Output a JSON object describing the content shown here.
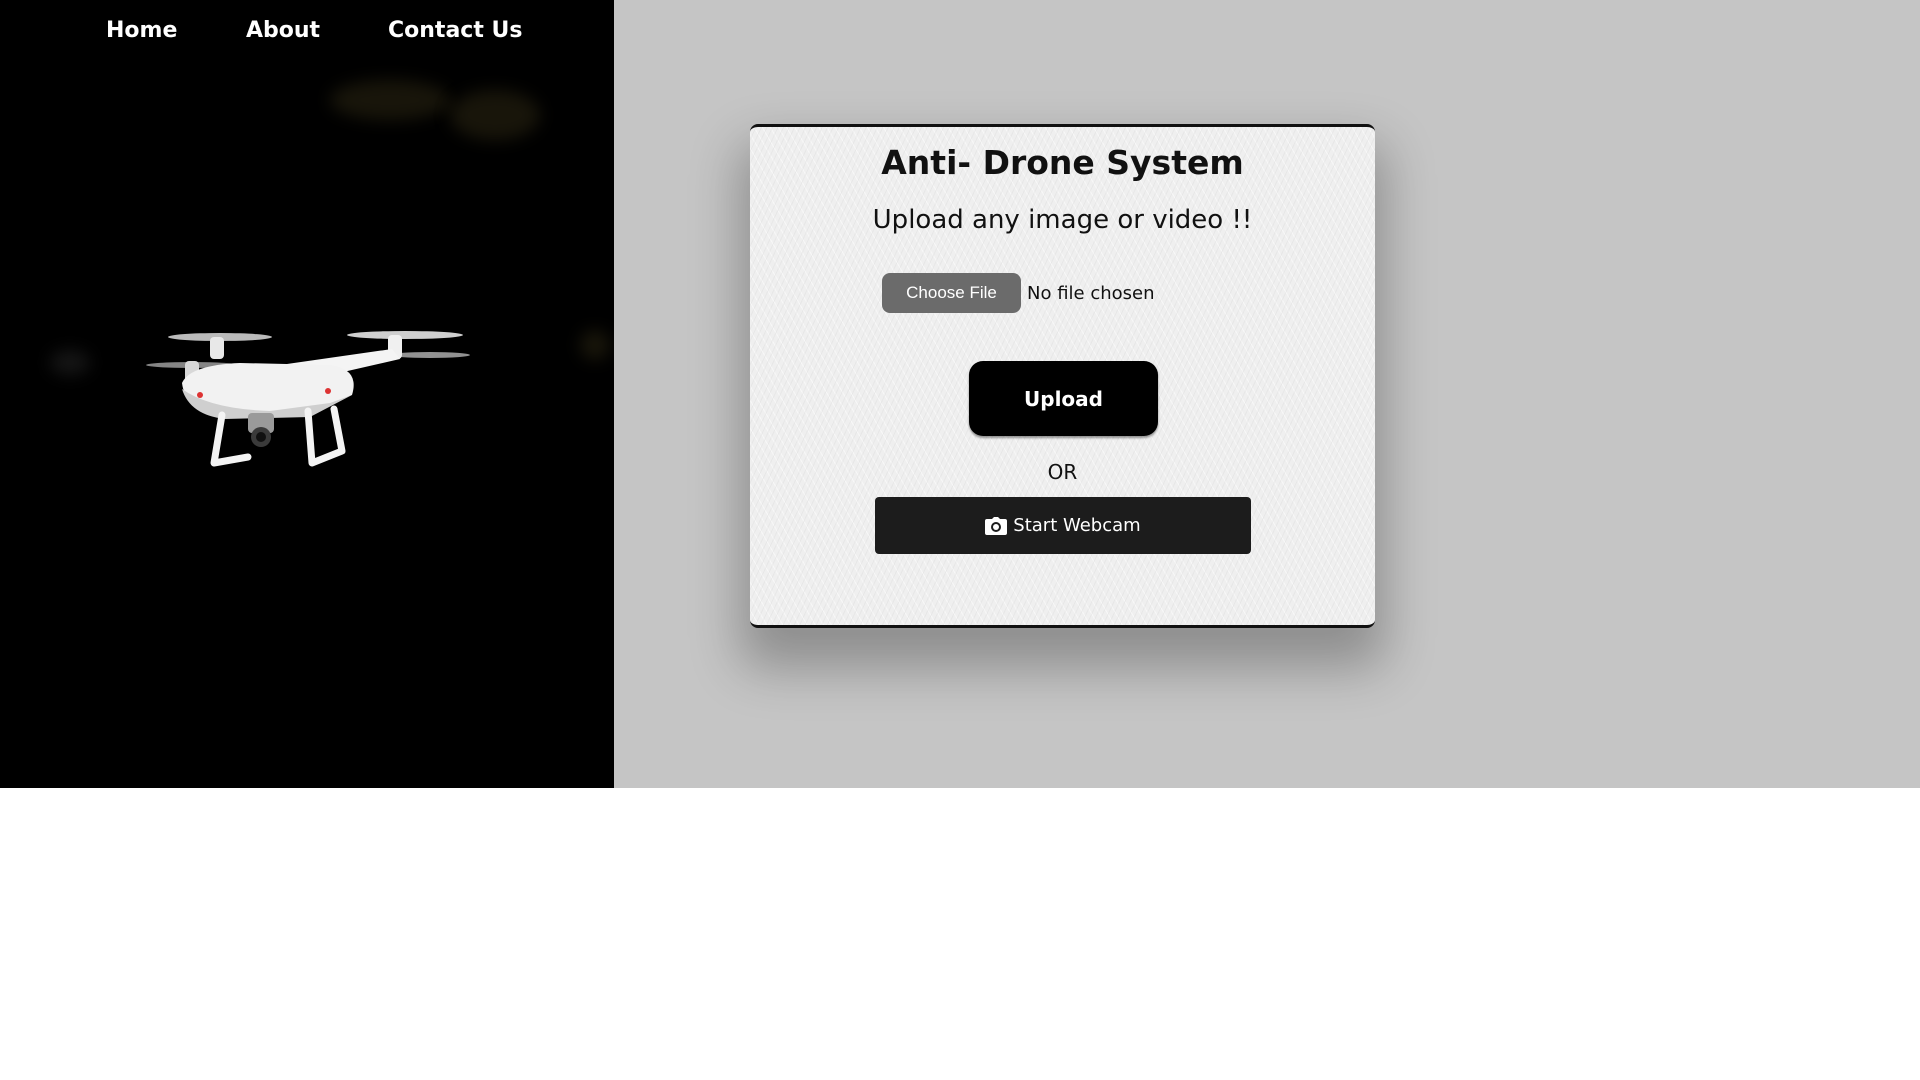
{
  "nav": {
    "items": [
      {
        "label": "Home"
      },
      {
        "label": "About"
      },
      {
        "label": "Contact Us"
      }
    ]
  },
  "hero": {
    "image_icon": "drone-icon"
  },
  "card": {
    "title": "Anti- Drone System",
    "subtitle": "Upload any image or video !!",
    "file_input": {
      "button_label": "Choose File",
      "status": "No file chosen"
    },
    "upload_label": "Upload",
    "or_label": "OR",
    "webcam": {
      "icon": "camera-icon",
      "label": "Start Webcam"
    }
  },
  "colors": {
    "hero_bg": "#000000",
    "right_bg": "#c5c5c5",
    "card_bg": "#efefef",
    "primary_button": "#000000",
    "webcam_button": "#1c1c1c",
    "choose_file_button": "#6b6b6b"
  }
}
